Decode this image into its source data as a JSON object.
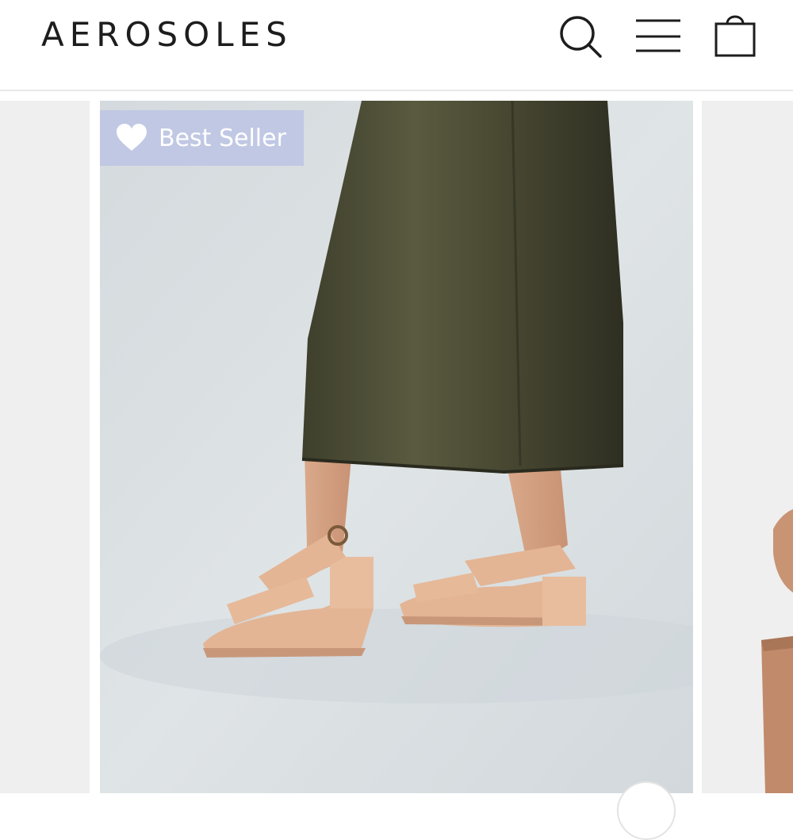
{
  "header": {
    "logo_text": "AEROSOLES",
    "icons": [
      "search-icon",
      "menu-icon",
      "shopping-bag-icon"
    ]
  },
  "product_gallery": {
    "badge": {
      "label": "Best Seller",
      "icon": "heart-icon",
      "background_color": "#c0c8e4"
    },
    "image_description_colors": {
      "dress": "#4a4a33",
      "sandal": "#e3b595",
      "backdrop": "#d7dde0"
    }
  }
}
